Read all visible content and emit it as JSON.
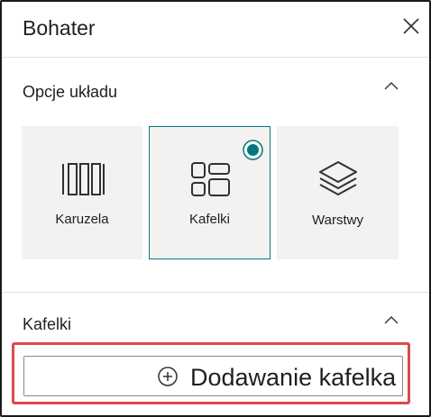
{
  "header": {
    "title": "Bohater",
    "close_icon": "close-icon"
  },
  "layout_section": {
    "title": "Opcje układu",
    "collapse_icon": "chevron-up-icon",
    "options": [
      {
        "label": "Karuzela",
        "icon": "carousel-icon",
        "selected": false
      },
      {
        "label": "Kafelki",
        "icon": "tiles-icon",
        "selected": true
      },
      {
        "label": "Warstwy",
        "icon": "layers-icon",
        "selected": false
      }
    ]
  },
  "tiles_section": {
    "title": "Kafelki",
    "collapse_icon": "chevron-up-icon",
    "add_button": {
      "label": "Dodawanie kafelka",
      "icon": "add-circle-icon"
    }
  },
  "colors": {
    "accent": "#03787c",
    "tile_background": "#f3f2f1",
    "highlight": "#e0474f",
    "divider": "#e1dfdd"
  }
}
